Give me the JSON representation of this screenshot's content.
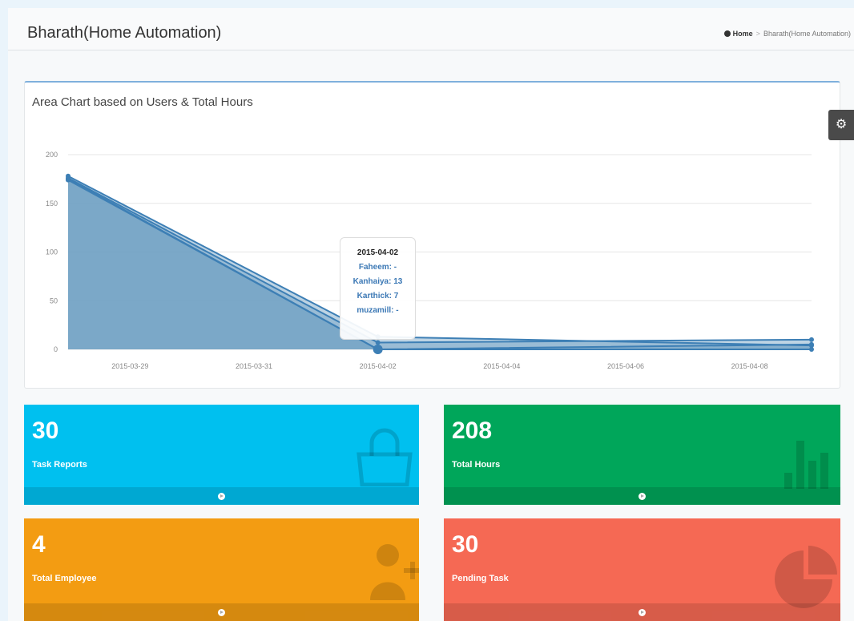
{
  "header": {
    "title": "Bharath(Home Automation)",
    "breadcrumb": {
      "home": "Home",
      "separator": ">",
      "current": "Bharath(Home Automation)"
    }
  },
  "settings": {
    "icon": "gear-icon"
  },
  "chart_data": {
    "type": "area",
    "title": "Area Chart based on Users & Total Hours",
    "xlabel": "",
    "ylabel": "",
    "ylim": [
      0,
      200
    ],
    "yticks": [
      "200",
      "150",
      "100",
      "50",
      "0"
    ],
    "xticks": [
      "2015-03-29",
      "2015-03-31",
      "2015-04-02",
      "2015-04-04",
      "2015-04-06",
      "2015-04-08"
    ],
    "x": [
      "2015-03-28",
      "2015-04-02",
      "2015-04-09"
    ],
    "series": [
      {
        "values": [
          178,
          13,
          4
        ]
      },
      {
        "values": [
          176,
          7,
          10
        ]
      },
      {
        "values": [
          175,
          0,
          5
        ]
      },
      {
        "values": [
          174,
          0,
          0
        ]
      }
    ],
    "grid": true,
    "color": "#3d7fb5",
    "fill": "#6f9fc3",
    "tooltip": {
      "date": "2015-04-02",
      "rows": [
        "Faheem: -",
        "Kanhaiya: 13",
        "Karthick: 7",
        "muzamill: -"
      ]
    }
  },
  "stats": [
    {
      "value": "30",
      "label": "Task Reports",
      "color": "#00c0ef",
      "icon": "shopping-bag-icon"
    },
    {
      "value": "208",
      "label": "Total Hours",
      "color": "#00a65a",
      "icon": "bar-chart-icon"
    },
    {
      "value": "4",
      "label": "Total Employee",
      "color": "#f39c12",
      "icon": "user-plus-icon"
    },
    {
      "value": "30",
      "label": "Pending Task",
      "color": "#f56954",
      "icon": "pie-chart-icon"
    }
  ]
}
